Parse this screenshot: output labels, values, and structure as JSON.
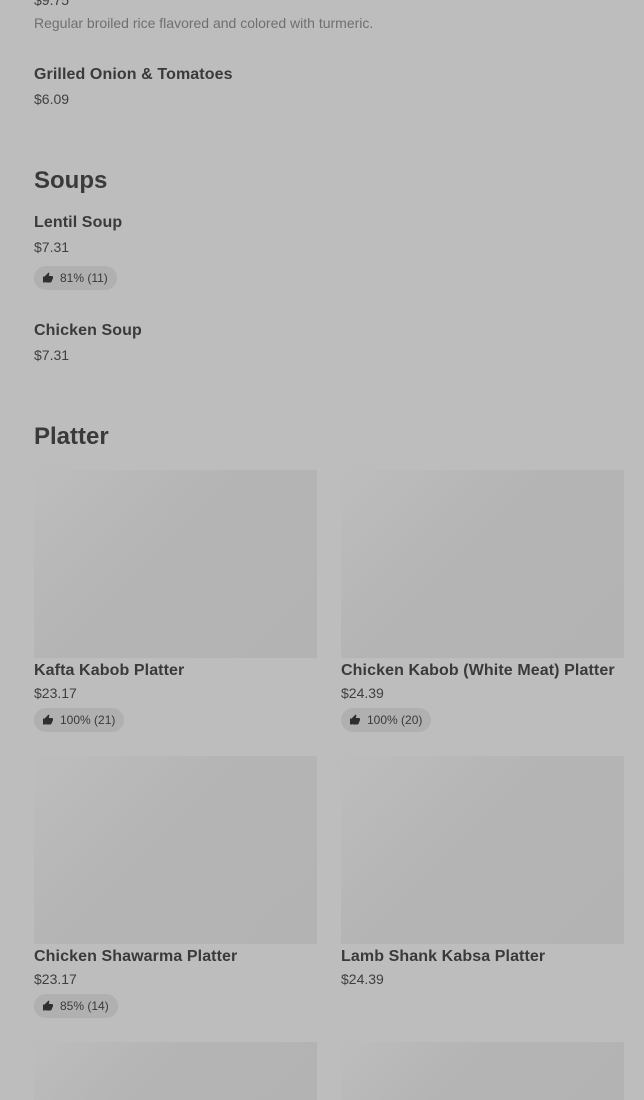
{
  "top_section": {
    "partial_price": "$9.75",
    "rice_description": "Regular broiled rice flavored and colored with turmeric.",
    "grilled": {
      "name": "Grilled Onion & Tomatoes",
      "price": "$6.09"
    }
  },
  "soups": {
    "title": "Soups",
    "items": [
      {
        "name": "Lentil Soup",
        "price": "$7.31",
        "rating": "81% (11)"
      },
      {
        "name": "Chicken Soup",
        "price": "$7.31"
      }
    ]
  },
  "platter": {
    "title": "Platter",
    "items": [
      {
        "name": "Kafta Kabob Platter",
        "price": "$23.17",
        "rating": "100% (21)"
      },
      {
        "name": "Chicken Kabob (White Meat) Platter",
        "price": "$24.39",
        "rating": "100% (20)"
      },
      {
        "name": "Chicken Shawarma Platter",
        "price": "$23.17",
        "rating": "85% (14)"
      },
      {
        "name": "Lamb Shank Kabsa Platter",
        "price": "$24.39"
      }
    ]
  },
  "icons": {
    "rating": "thumbs-up-icon"
  },
  "colors": {
    "background": "#bdbdbd",
    "badge": "#b0b0b0",
    "image_placeholder": "#b4b4b4"
  }
}
